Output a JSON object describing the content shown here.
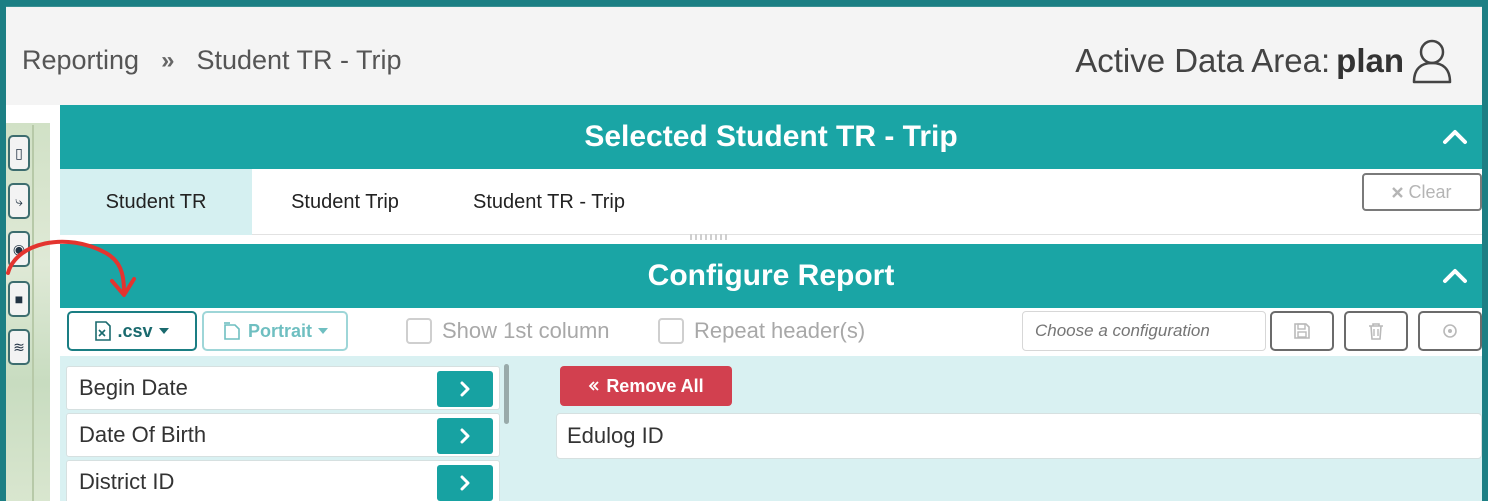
{
  "header": {
    "breadcrumb": [
      "Reporting",
      "Student TR - Trip"
    ],
    "breadcrumb_separator": "»",
    "active_area_label": "Active Data Area:",
    "active_area_value": "plan"
  },
  "selected_panel": {
    "title": "Selected Student TR - Trip",
    "tabs": [
      {
        "label": "Student TR",
        "active": true
      },
      {
        "label": "Student Trip",
        "active": false
      },
      {
        "label": "Student TR - Trip",
        "active": false
      }
    ],
    "clear_label": "Clear"
  },
  "configure_panel": {
    "title": "Configure Report",
    "format_label": ".csv",
    "orientation_label": "Portrait",
    "show_first_column_label": "Show 1st column",
    "repeat_header_label": "Repeat header(s)",
    "config_placeholder": "Choose a configuration",
    "available_fields": [
      "Begin Date",
      "Date Of Birth",
      "District ID"
    ],
    "remove_all_label": "Remove All",
    "selected_fields": [
      "Edulog ID"
    ]
  },
  "colors": {
    "teal": "#1aa5a5",
    "light_teal": "#d9f1f2",
    "remove_red": "#d2404f",
    "frame": "#1c7f84"
  },
  "icons": [
    "chevron-up-icon",
    "user-icon",
    "excel-file-icon",
    "portrait-page-icon",
    "save-icon",
    "trash-icon",
    "reset-icon",
    "chevron-right-icon",
    "double-left-icon",
    "close-icon"
  ]
}
